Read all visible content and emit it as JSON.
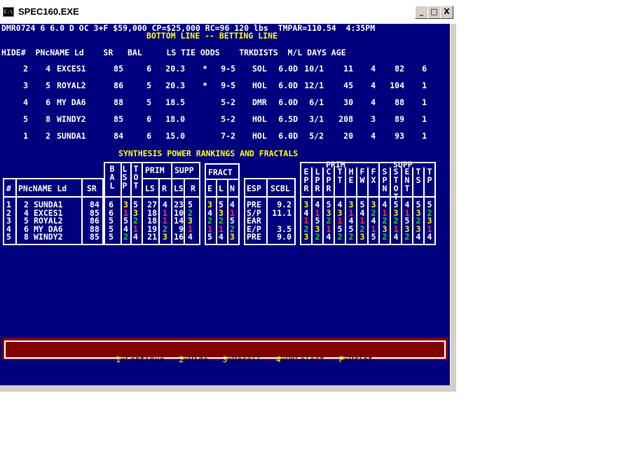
{
  "window": {
    "title": "SPEC160.EXE",
    "icon_label": "C:\\",
    "min_label": "_",
    "max_label": "□",
    "close_label": "X"
  },
  "header": {
    "info_line": "DMR0724 6 6.0 D OC 3+F $59,000 CP=$25,000 RC=96 120 lbs  TMPAR=110.54  4:35PM",
    "subtitle": "BOTTOM LINE -- BETTING LINE",
    "columns": "HIDE#  PNcNAME Ld    SR   BAL     LS TIE ODDS    TRKDISTS  M/L DAYS AGE"
  },
  "betting_rows": [
    {
      "hide": "2",
      "pn": "4",
      "name": "EXCES1",
      "sr": "85",
      "bal": "6",
      "ls": "20.3",
      "tie": "*",
      "odds": "9-5",
      "trk": "SOL",
      "dist": "6.0D",
      "ml": "10/1",
      "days": "11",
      "age": "4",
      "c13": "82",
      "c14": "6"
    },
    {
      "hide": "3",
      "pn": "5",
      "name": "ROYAL2",
      "sr": "86",
      "bal": "5",
      "ls": "20.3",
      "tie": "*",
      "odds": "9-5",
      "trk": "HOL",
      "dist": "6.0D",
      "ml": "12/1",
      "days": "45",
      "age": "4",
      "c13": "104",
      "c14": "1"
    },
    {
      "hide": "4",
      "pn": "6",
      "name": "MY DA6",
      "sr": "88",
      "bal": "5",
      "ls": "18.5",
      "tie": "",
      "odds": "5-2",
      "trk": "DMR",
      "dist": "6.0D",
      "ml": "6/1",
      "days": "30",
      "age": "4",
      "c13": "88",
      "c14": "1"
    },
    {
      "hide": "5",
      "pn": "8",
      "name": "WINDY2",
      "sr": "85",
      "bal": "6",
      "ls": "18.0",
      "tie": "",
      "odds": "5-2",
      "trk": "HOL",
      "dist": "6.5D",
      "ml": "3/1",
      "days": "208",
      "age": "3",
      "c13": "89",
      "c14": "1"
    },
    {
      "hide": "1",
      "pn": "2",
      "name": "SUNDA1",
      "sr": "84",
      "bal": "6",
      "ls": "15.0",
      "tie": "",
      "odds": "7-2",
      "trk": "HOL",
      "dist": "6.0D",
      "ml": "5/2",
      "days": "20",
      "age": "4",
      "c13": "93",
      "c14": "1"
    }
  ],
  "synthesis": {
    "title": "SYNTHESIS POWER RANKINGS AND FRACTALS",
    "h_hash": "#",
    "h_name": "PNcNAME Ld",
    "h_sr": "SR",
    "h_prim": "PRIM",
    "h_supp": "SUPP",
    "h_fract": "FRACT",
    "h_esp": "ESP",
    "h_scbl": "SCBL",
    "h_prim2": "PRIM",
    "h_supp2": "SUPP",
    "vert_left": [
      "BAL",
      "LSP",
      "TOT"
    ],
    "sub_prim": [
      "LS",
      "R"
    ],
    "sub_supp": [
      "LS",
      "R"
    ],
    "sub_fract": [
      "E",
      "L",
      "N"
    ],
    "vert_right": [
      "EPR",
      "LPR",
      "CPR",
      "TT",
      "HE",
      "FW",
      "FX",
      "SPN",
      "STOT",
      "ENT",
      "TS",
      "TP"
    ],
    "rows": [
      {
        "n": "1",
        "pn": "2",
        "name": "SUNDA1",
        "sr": "84",
        "v": [
          "6",
          "3",
          "5",
          "27",
          "4",
          "23",
          "5"
        ],
        "f": [
          "3",
          "5",
          "4"
        ],
        "esp": "PRE",
        "scbl": "9.2",
        "rc": [
          "3",
          "4",
          "5",
          "4",
          "3",
          "5",
          "3",
          "4",
          "5",
          "4",
          "5",
          "5"
        ]
      },
      {
        "n": "2",
        "pn": "4",
        "name": "EXCES1",
        "sr": "85",
        "v": [
          "6",
          "1",
          "3",
          "18",
          "1",
          "10",
          "2"
        ],
        "f": [
          "4",
          "3",
          "1"
        ],
        "esp": "S/P",
        "scbl": "11.1",
        "rc": [
          "4",
          "1",
          "3",
          "3",
          "1",
          "4",
          "2",
          "1",
          "3",
          "1",
          "3",
          "2"
        ]
      },
      {
        "n": "3",
        "pn": "5",
        "name": "ROYAL2",
        "sr": "86",
        "v": [
          "5",
          "5",
          "2",
          "18",
          "1",
          "14",
          "3"
        ],
        "f": [
          "2",
          "2",
          "5"
        ],
        "esp": "EAR",
        "scbl": "",
        "rc": [
          "1",
          "5",
          "2",
          "1",
          "4",
          "1",
          "4",
          "2",
          "2",
          "5",
          "2",
          "3"
        ]
      },
      {
        "n": "4",
        "pn": "6",
        "name": "MY DA6",
        "sr": "88",
        "v": [
          "5",
          "4",
          "1",
          "19",
          "2",
          "9",
          "1"
        ],
        "f": [
          "1",
          "1",
          "2"
        ],
        "esp": "E/P",
        "scbl": "3.5",
        "rc": [
          "2",
          "3",
          "1",
          "5",
          "5",
          "2",
          "1",
          "3",
          "1",
          "3",
          "3",
          "1"
        ]
      },
      {
        "n": "5",
        "pn": "8",
        "name": "WINDY2",
        "sr": "85",
        "v": [
          "5",
          "2",
          "4",
          "21",
          "3",
          "16",
          "4"
        ],
        "f": [
          "5",
          "4",
          "3"
        ],
        "esp": "PRE",
        "scbl": "9.0",
        "rc": [
          "3",
          "2",
          "4",
          "2",
          "2",
          "3",
          "5",
          "2",
          "4",
          "2",
          "4",
          "4"
        ]
      }
    ]
  },
  "footer": {
    "k1": "1",
    "l1": "=Continue",
    "k2": "2",
    "l2": "=Hide",
    "k3": "3",
    "l3": "=Recall",
    "k4": "4",
    "l4": "=UnSelect",
    "k5": "P",
    "l5": "=Print"
  },
  "colors": {
    "console_bg": "#00007f",
    "highlight": "#ffff00",
    "rank_red": "#ff3333",
    "rank_green": "#33cc33",
    "footer_bg": "#800000"
  }
}
